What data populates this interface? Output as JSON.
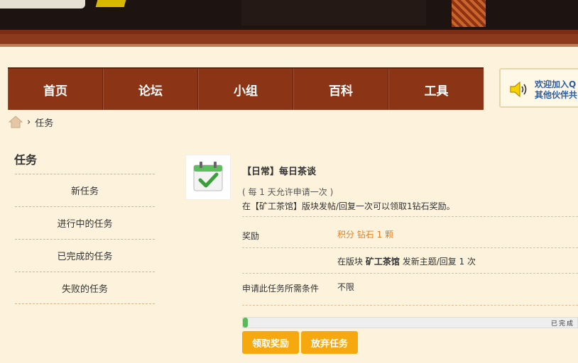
{
  "nav": {
    "items": [
      {
        "label": "首页"
      },
      {
        "label": "论坛"
      },
      {
        "label": "小组"
      },
      {
        "label": "百科"
      },
      {
        "label": "工具"
      }
    ]
  },
  "notice": {
    "line1": "欢迎加入Q",
    "line2": "其他伙伴共"
  },
  "breadcrumb": {
    "separator": "›",
    "current": "任务"
  },
  "sidebar": {
    "title": "任务",
    "items": [
      {
        "label": "新任务"
      },
      {
        "label": "进行中的任务"
      },
      {
        "label": "已完成的任务"
      },
      {
        "label": "失败的任务"
      }
    ]
  },
  "task": {
    "title": "【日常】每日茶谈",
    "apply_limit": "( 每 1 天允许申请一次 )",
    "description": "在【矿工茶馆】版块发帖/回复一次可以领取1钻石奖励。",
    "reward_label": "奖励",
    "reward_value": "积分 钻石 1 颗",
    "requirement_prefix": "在版块",
    "requirement_forum": "矿工茶馆",
    "requirement_suffix": "发新主题/回复 1 次",
    "condition_label": "申请此任务所需条件",
    "condition_value": "不限",
    "progress_text": "已完成",
    "progress_percent": 1
  },
  "buttons": {
    "claim": "领取奖励",
    "abandon": "放弃任务"
  },
  "colors": {
    "nav_bg": "#8c3416",
    "page_bg": "#fdf3dc",
    "button": "#f6a80f",
    "reward_text": "#e67e22",
    "progress_fill": "#5cb85c"
  }
}
